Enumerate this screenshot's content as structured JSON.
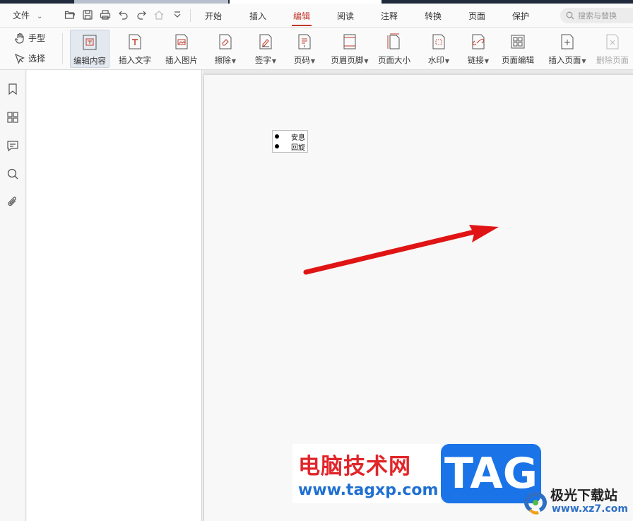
{
  "menubar": {
    "file_label": "文件",
    "tabs": [
      "开始",
      "插入",
      "编辑",
      "阅读",
      "注释",
      "转换",
      "页面",
      "保护"
    ],
    "active_tab": "编辑",
    "search_placeholder": "搜索与替换"
  },
  "modes": {
    "hand_label": "手型",
    "select_label": "选择"
  },
  "ribbon": {
    "tools": [
      {
        "label": "编辑内容",
        "icon": "edit-content-icon",
        "active": true
      },
      {
        "label": "插入文字",
        "icon": "insert-text-icon"
      },
      {
        "label": "插入图片",
        "icon": "insert-image-icon"
      },
      {
        "label": "擦除",
        "icon": "eraser-icon",
        "dropdown": true
      },
      {
        "label": "签字",
        "icon": "signature-icon",
        "dropdown": true
      },
      {
        "label": "页码",
        "icon": "page-number-icon",
        "dropdown": true
      },
      {
        "label": "页眉页脚",
        "icon": "header-footer-icon",
        "dropdown": true
      },
      {
        "label": "页面大小",
        "icon": "page-size-icon"
      },
      {
        "label": "水印",
        "icon": "watermark-icon",
        "dropdown": true
      },
      {
        "label": "链接",
        "icon": "link-icon",
        "dropdown": true
      },
      {
        "label": "页面编辑",
        "icon": "page-edit-icon"
      },
      {
        "label": "插入页面",
        "icon": "insert-page-icon",
        "dropdown": true
      },
      {
        "label": "删除页面",
        "icon": "delete-page-icon",
        "disabled": true
      }
    ]
  },
  "document": {
    "bullets": [
      "安息",
      "回旋"
    ]
  },
  "watermark": {
    "site_cn": "电脑技术网",
    "site_url": "www.tagxp.com",
    "tag": "TAG",
    "brand_name": "极光下载站",
    "brand_url": "www.xz7.com"
  },
  "colors": {
    "accent": "#c0392b",
    "arrow": "#e01414",
    "tag_blue": "#1a74e8"
  }
}
